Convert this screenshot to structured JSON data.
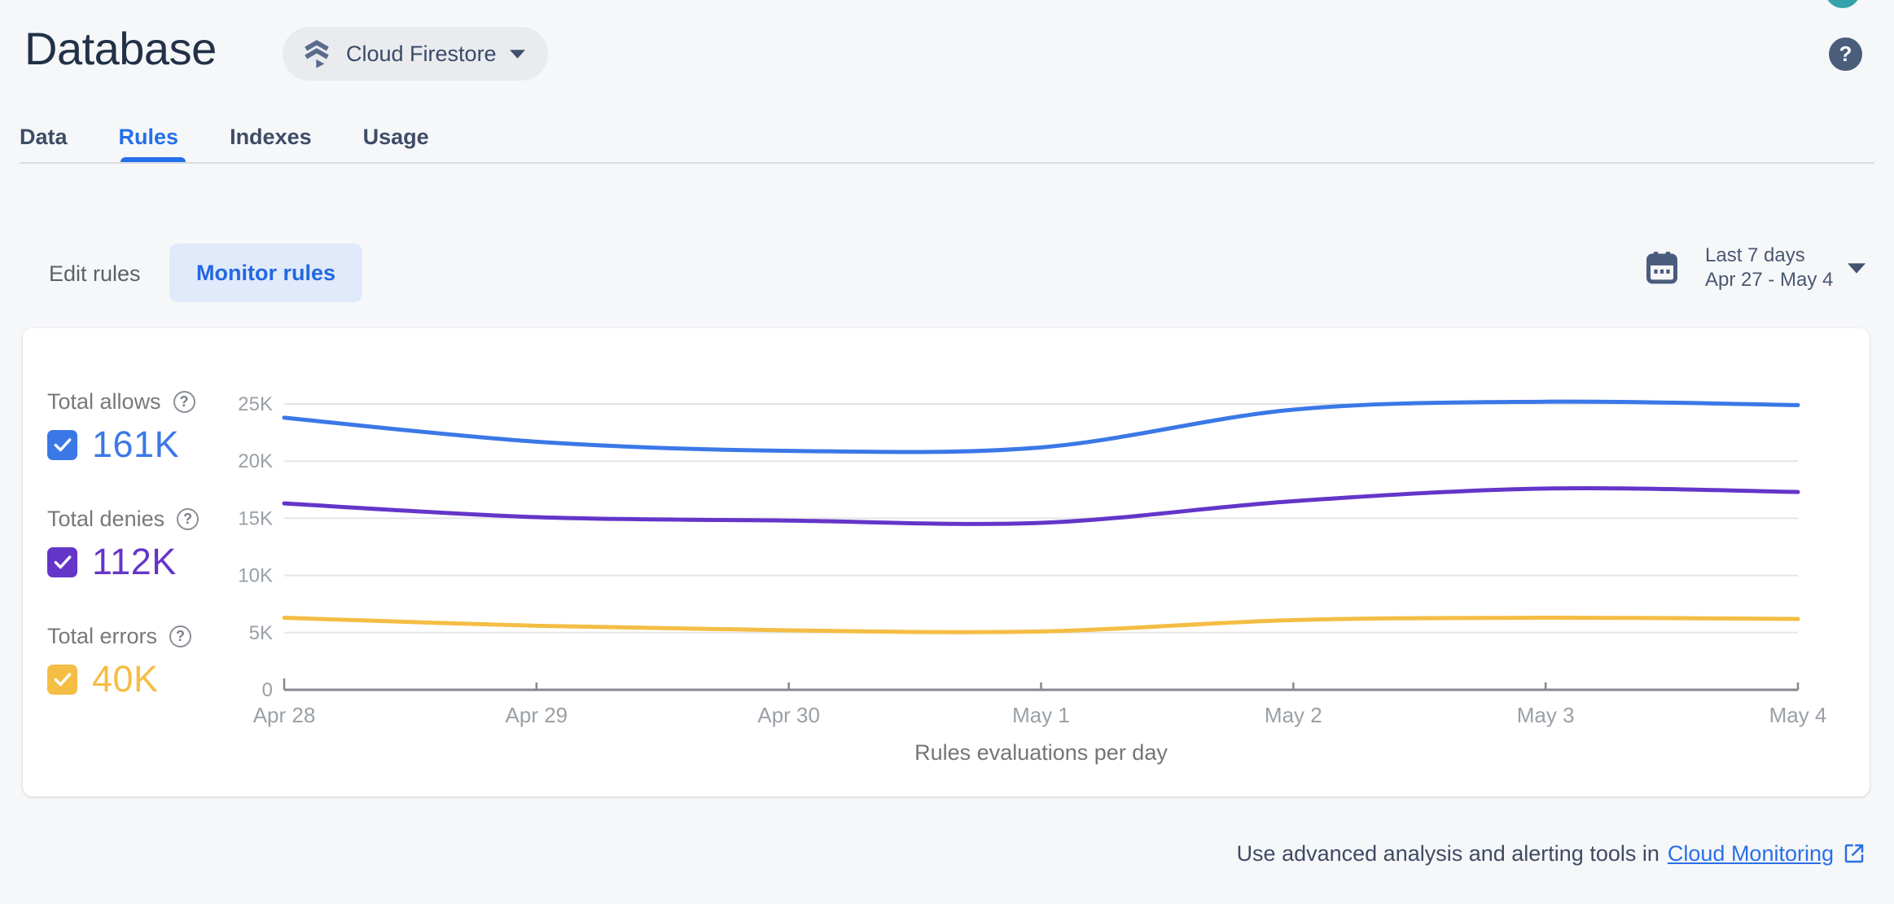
{
  "header": {
    "title": "Database",
    "product_selector_label": "Cloud Firestore",
    "help_glyph": "?"
  },
  "tabs": {
    "data": "Data",
    "rules": "Rules",
    "indexes": "Indexes",
    "usage": "Usage",
    "active_tab": "Rules"
  },
  "toolbar": {
    "edit_rules_label": "Edit rules",
    "monitor_rules_label": "Monitor rules",
    "date_range": {
      "preset": "Last 7 days",
      "range": "Apr 27 - May 4"
    }
  },
  "legend": {
    "allows": {
      "label": "Total allows",
      "value": "161K",
      "color": "#3B78E7",
      "checked": true
    },
    "denies": {
      "label": "Total denies",
      "value": "112K",
      "color": "#6435C9",
      "checked": true
    },
    "errors": {
      "label": "Total errors",
      "value": "40K",
      "color": "#F4BD44",
      "checked": true
    }
  },
  "chart_data": {
    "type": "line",
    "title": "Rules evaluations per day",
    "x": [
      "Apr 28",
      "Apr 29",
      "Apr 30",
      "May 1",
      "May 2",
      "May 3",
      "May 4"
    ],
    "series": [
      {
        "name": "Total allows",
        "color": "#3B78E7",
        "values": [
          23800,
          21700,
          20900,
          21200,
          24500,
          25200,
          24900
        ]
      },
      {
        "name": "Total denies",
        "color": "#6435C9",
        "values": [
          16300,
          15100,
          14800,
          14600,
          16500,
          17600,
          17300
        ]
      },
      {
        "name": "Total errors",
        "color": "#F4BD44",
        "values": [
          6300,
          5600,
          5200,
          5100,
          6100,
          6300,
          6200
        ]
      }
    ],
    "ylim": [
      0,
      25000
    ],
    "yticks": [
      {
        "value": 0,
        "label": "0"
      },
      {
        "value": 5000,
        "label": "5K"
      },
      {
        "value": 10000,
        "label": "10K"
      },
      {
        "value": 15000,
        "label": "15K"
      },
      {
        "value": 20000,
        "label": "20K"
      },
      {
        "value": 25000,
        "label": "25K"
      }
    ],
    "grid": "horizontal",
    "legend_position": "left"
  },
  "footer": {
    "text": "Use advanced analysis and alerting tools in",
    "link_label": "Cloud Monitoring"
  },
  "colors": {
    "page_bg": "#F6F7F9",
    "card_bg": "#FFFFFF",
    "tab_active": "#2570E8",
    "link": "#2A6FE8",
    "axis_label": "#9AA0A6",
    "axis_line": "#85888E",
    "gridline": "#E4E5E7",
    "chart_caption": "#757575"
  }
}
